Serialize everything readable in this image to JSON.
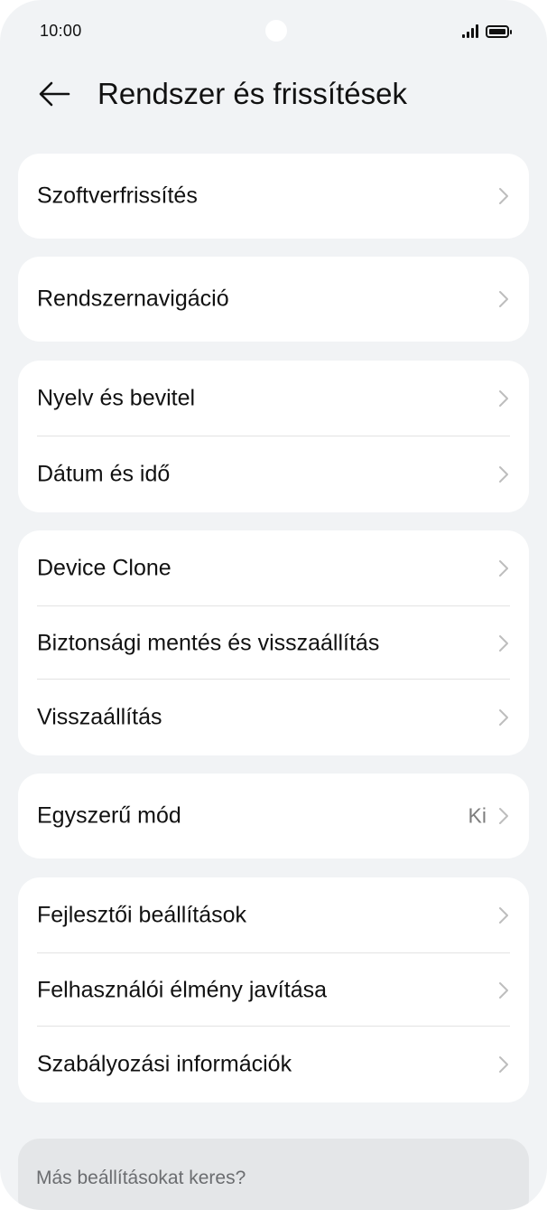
{
  "status_bar": {
    "time": "10:00"
  },
  "header": {
    "title": "Rendszer és frissítések",
    "back_icon": "arrow-left-icon"
  },
  "groups": [
    {
      "items": [
        {
          "label": "Szoftverfrissítés"
        }
      ]
    },
    {
      "items": [
        {
          "label": "Rendszernavigáció"
        }
      ]
    },
    {
      "items": [
        {
          "label": "Nyelv és bevitel"
        },
        {
          "label": "Dátum és idő"
        }
      ]
    },
    {
      "items": [
        {
          "label": "Device Clone"
        },
        {
          "label": "Biztonsági mentés és visszaállítás"
        },
        {
          "label": "Visszaállítás"
        }
      ]
    },
    {
      "items": [
        {
          "label": "Egyszerű mód",
          "value": "Ki"
        }
      ]
    },
    {
      "items": [
        {
          "label": "Fejlesztői beállítások"
        },
        {
          "label": "Felhasználói élmény javítása"
        },
        {
          "label": "Szabályozási információk"
        }
      ]
    }
  ],
  "search_prompt": {
    "text": "Más beállításokat keres?"
  },
  "colors": {
    "background": "#f1f3f5",
    "card": "#ffffff",
    "chevron": "#bdbdbd"
  }
}
